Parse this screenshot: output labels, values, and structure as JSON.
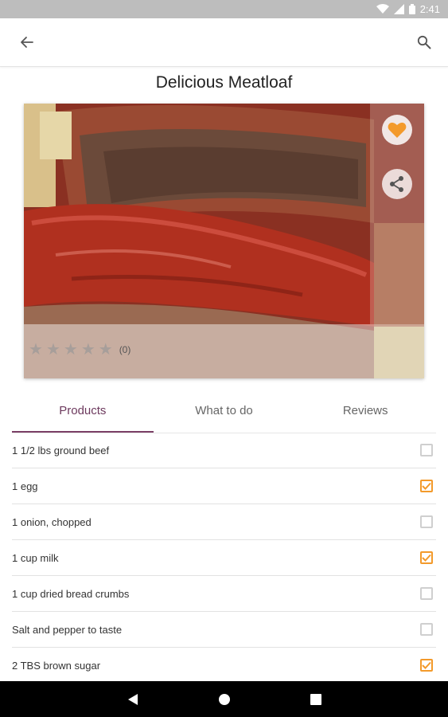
{
  "status": {
    "time": "2:41"
  },
  "recipe": {
    "title": "Delicious Meatloaf",
    "rating_count": "(0)"
  },
  "tabs": [
    {
      "label": "Products",
      "active": true
    },
    {
      "label": "What to do",
      "active": false
    },
    {
      "label": "Reviews",
      "active": false
    }
  ],
  "ingredients": [
    {
      "label": "1 1/2 lbs ground beef",
      "checked": false
    },
    {
      "label": "1 egg",
      "checked": true
    },
    {
      "label": "1 onion, chopped",
      "checked": false
    },
    {
      "label": "1 cup milk",
      "checked": true
    },
    {
      "label": "1 cup dried bread crumbs",
      "checked": false
    },
    {
      "label": "Salt and pepper to taste",
      "checked": false
    },
    {
      "label": "2 TBS brown sugar",
      "checked": true
    }
  ],
  "colors": {
    "accent": "#f39a2b",
    "tab_active": "#7b3f66",
    "status_bar": "#bdbdbd"
  },
  "icons": [
    "wifi-icon",
    "signal-icon",
    "battery-icon",
    "back-arrow-icon",
    "search-icon",
    "heart-icon",
    "share-icon",
    "star-icon",
    "nav-back-icon",
    "nav-home-icon",
    "nav-recents-icon"
  ]
}
